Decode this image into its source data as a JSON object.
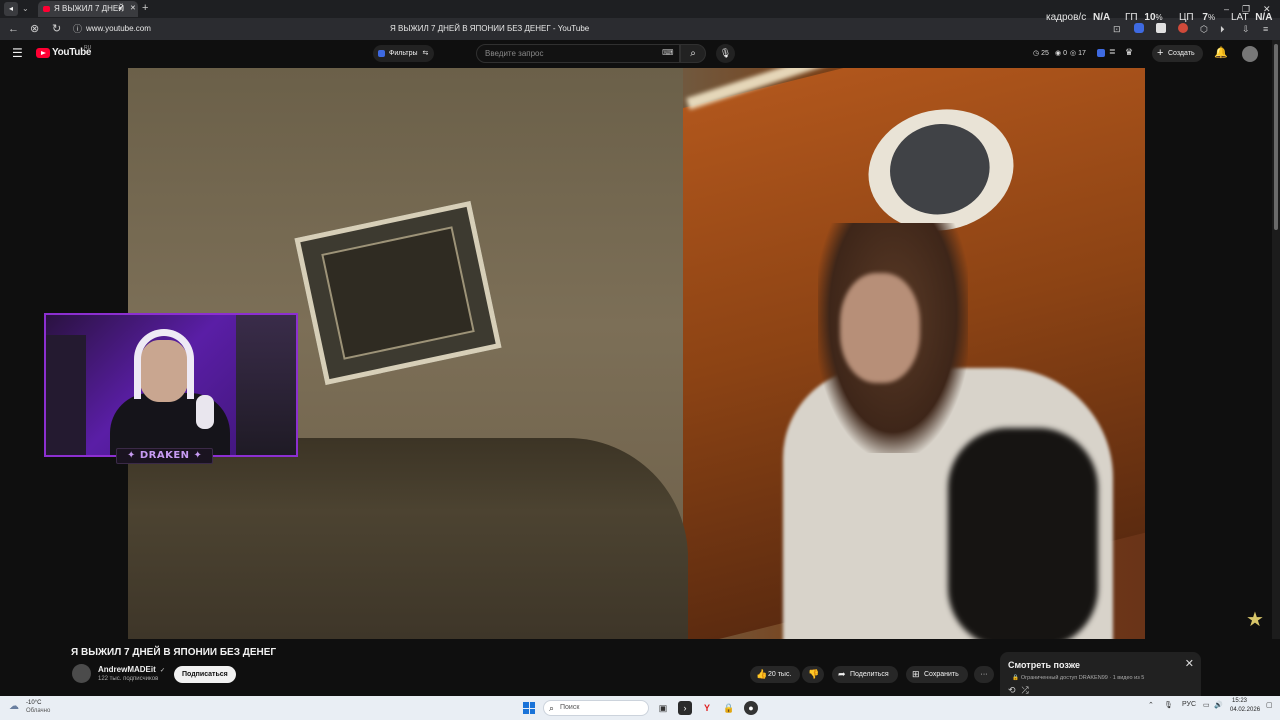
{
  "browser": {
    "tab_label": "Я ВЫЖИЛ 7 ДНЕЙ",
    "new_tab": "+",
    "url": "www.youtube.com",
    "page_title": "Я ВЫЖИЛ 7 ДНЕЙ В ЯПОНИИ БЕЗ ДЕНЕГ - YouTube",
    "window_controls": {
      "minimize": "–",
      "restore": "❐",
      "close": "✕"
    }
  },
  "perf_overlay": {
    "fps_label": "кадров/с",
    "fps_value": "N/A",
    "gpu_label": "ГП",
    "gpu_value": "10",
    "cpu_label": "ЦП",
    "cpu_value": "7",
    "percent": "%",
    "lat_label": "LAT",
    "lat_value": "N/A"
  },
  "youtube_header": {
    "logo_text": "YouTube",
    "region": "RU",
    "filters_label": "Фильтры",
    "search_placeholder": "Введите запрос",
    "stats": {
      "views": "25",
      "zero": "0",
      "likes": "17"
    },
    "create_label": "Создать"
  },
  "webcam": {
    "badge_text": "✦ DRAKEN ✦"
  },
  "video_info": {
    "title": "Я ВЫЖИЛ 7 ДНЕЙ В ЯПОНИИ БЕЗ ДЕНЕГ",
    "channel_name": "AndrewMADEit",
    "verified": "✓",
    "subscribers": "122 тыс. подписчиков",
    "subscribe_label": "Подписаться",
    "like_count": "20 тыс.",
    "share_label": "Поделиться",
    "save_label": "Сохранить",
    "more": "···"
  },
  "watch_later": {
    "title": "Смотреть позже",
    "subtitle": "Ограниченный доступ DRAKEN99 · 1 видео из 5",
    "close": "✕"
  },
  "taskbar": {
    "temperature": "-10°C",
    "condition": "Облачно",
    "search_placeholder": "Поиск",
    "language": "РУС",
    "time": "15:23",
    "date": "04.02.2026"
  },
  "colors": {
    "youtube_red": "#ff0033",
    "webcam_border": "#8c2fd1",
    "orange_wall": "#b0561c"
  }
}
